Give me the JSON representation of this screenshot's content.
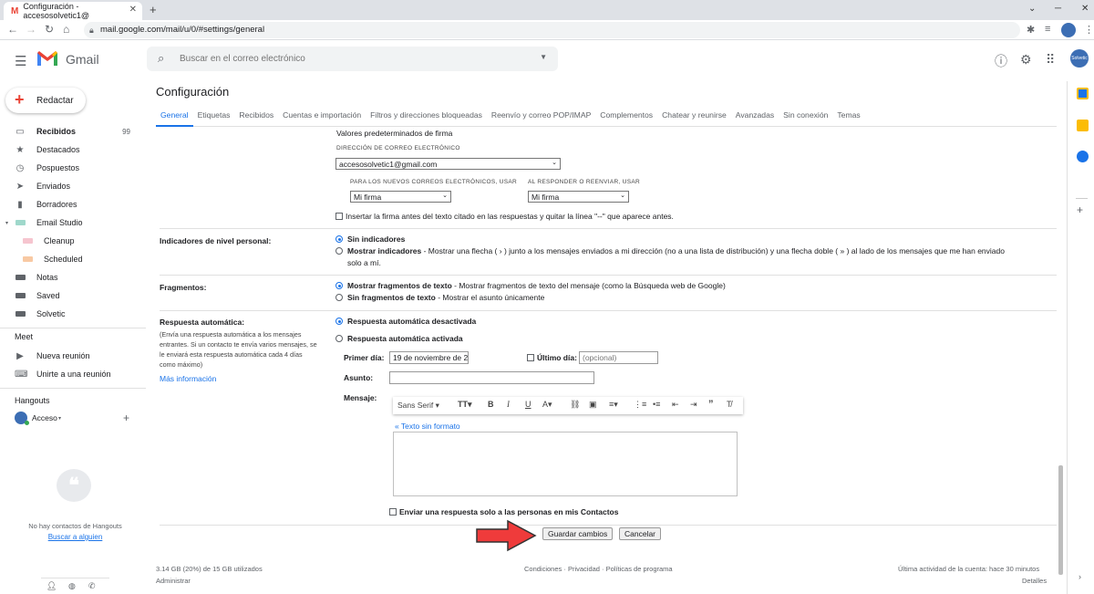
{
  "browser": {
    "tab_title": "Configuración - accesosolvetic1@",
    "url": "mail.google.com/mail/u/0/#settings/general"
  },
  "gmail": {
    "product": "Gmail",
    "search_placeholder": "Buscar en el correo electrónico",
    "compose": "Redactar"
  },
  "sidebar": {
    "items": [
      {
        "icon": "inbox-icon",
        "label": "Recibidos",
        "count": "99"
      },
      {
        "icon": "star-icon",
        "label": "Destacados"
      },
      {
        "icon": "clock-icon",
        "label": "Pospuestos"
      },
      {
        "icon": "send-icon",
        "label": "Enviados"
      },
      {
        "icon": "draft-icon",
        "label": "Borradores"
      },
      {
        "icon": "label-icon",
        "label": "Email Studio"
      },
      {
        "icon": "label-icon",
        "label": "Cleanup"
      },
      {
        "icon": "label-icon",
        "label": "Scheduled"
      },
      {
        "icon": "label-icon",
        "label": "Notas"
      },
      {
        "icon": "label-icon",
        "label": "Saved"
      },
      {
        "icon": "label-icon",
        "label": "Solvetic"
      }
    ],
    "meet_title": "Meet",
    "meet_items": [
      "Nueva reunión",
      "Unirte a una reunión"
    ],
    "hangouts_title": "Hangouts",
    "hangouts_user": "Acceso",
    "no_contacts": "No hay contactos de Hangouts",
    "find_someone": "Buscar a alguien"
  },
  "settings": {
    "title": "Configuración",
    "tabs": [
      "General",
      "Etiquetas",
      "Recibidos",
      "Cuentas e importación",
      "Filtros y direcciones bloqueadas",
      "Reenvío y correo POP/IMAP",
      "Complementos",
      "Chatear y reunirse",
      "Avanzadas",
      "Sin conexión",
      "Temas"
    ],
    "signature": {
      "heading": "Valores predeterminados de firma",
      "email_label": "DIRECCIÓN DE CORREO ELECTRÓNICO",
      "email_value": "accesosolvetic1@gmail.com",
      "new_label": "PARA LOS NUEVOS CORREOS ELECTRÓNICOS, USAR",
      "new_value": "Mi firma",
      "reply_label": "AL RESPONDER O REENVIAR, USAR",
      "reply_value": "Mi firma",
      "insert_checkbox": "Insertar la firma antes del texto citado en las respuestas y quitar la línea \"--\" que aparece antes."
    },
    "indicators": {
      "label": "Indicadores de nivel personal:",
      "opt1": "Sin indicadores",
      "opt2_bold": "Mostrar indicadores",
      "opt2_desc": " - Mostrar una flecha ( › ) junto a los mensajes enviados a mi dirección (no a una lista de distribución) y una flecha doble ( » ) al lado de los mensajes que me han enviado",
      "opt2_desc2": "solo a mí."
    },
    "snippets": {
      "label": "Fragmentos:",
      "opt1_bold": "Mostrar fragmentos de texto",
      "opt1_desc": " - Mostrar fragmentos de texto del mensaje (como la Búsqueda web de Google)",
      "opt2_bold": "Sin fragmentos de texto",
      "opt2_desc": " - Mostrar el asunto únicamente"
    },
    "autoreply": {
      "label": "Respuesta automática:",
      "desc": [
        "(Envía una respuesta automática a los mensajes",
        "entrantes. Si un contacto te envía varios mensajes, se",
        "le enviará esta respuesta automática cada 4 días",
        "como máximo)"
      ],
      "more": "Más información",
      "off": "Respuesta automática desactivada",
      "on": "Respuesta automática activada",
      "first_day": "Primer día:",
      "first_day_value": "19 de noviembre de 2",
      "last_day": "Último día:",
      "last_day_placeholder": "(opcional)",
      "subject": "Asunto:",
      "message": "Mensaje:",
      "font": "Sans Serif",
      "plain_text": "« Texto sin formato",
      "contacts_only": "Enviar una respuesta solo a las personas en mis Contactos"
    },
    "save": "Guardar cambios",
    "cancel": "Cancelar"
  },
  "footer": {
    "storage": "3.14 GB (20%) de 15 GB utilizados",
    "manage": "Administrar",
    "terms": "Condiciones · Privacidad · Políticas de programa",
    "activity": "Última actividad de la cuenta: hace 30 minutos",
    "details": "Detalles"
  },
  "colors": {
    "accent": "#1a73e8",
    "arrow": "#ef3b3b"
  }
}
